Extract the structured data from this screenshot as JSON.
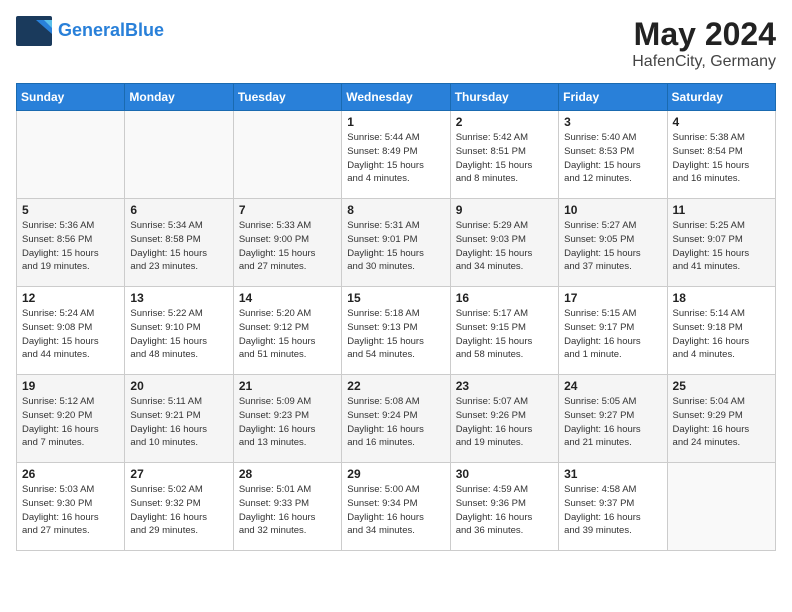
{
  "header": {
    "logo_general": "General",
    "logo_blue": "Blue",
    "title": "May 2024",
    "subtitle": "HafenCity, Germany"
  },
  "columns": [
    "Sunday",
    "Monday",
    "Tuesday",
    "Wednesday",
    "Thursday",
    "Friday",
    "Saturday"
  ],
  "weeks": [
    [
      {
        "num": "",
        "info": ""
      },
      {
        "num": "",
        "info": ""
      },
      {
        "num": "",
        "info": ""
      },
      {
        "num": "1",
        "info": "Sunrise: 5:44 AM\nSunset: 8:49 PM\nDaylight: 15 hours\nand 4 minutes."
      },
      {
        "num": "2",
        "info": "Sunrise: 5:42 AM\nSunset: 8:51 PM\nDaylight: 15 hours\nand 8 minutes."
      },
      {
        "num": "3",
        "info": "Sunrise: 5:40 AM\nSunset: 8:53 PM\nDaylight: 15 hours\nand 12 minutes."
      },
      {
        "num": "4",
        "info": "Sunrise: 5:38 AM\nSunset: 8:54 PM\nDaylight: 15 hours\nand 16 minutes."
      }
    ],
    [
      {
        "num": "5",
        "info": "Sunrise: 5:36 AM\nSunset: 8:56 PM\nDaylight: 15 hours\nand 19 minutes."
      },
      {
        "num": "6",
        "info": "Sunrise: 5:34 AM\nSunset: 8:58 PM\nDaylight: 15 hours\nand 23 minutes."
      },
      {
        "num": "7",
        "info": "Sunrise: 5:33 AM\nSunset: 9:00 PM\nDaylight: 15 hours\nand 27 minutes."
      },
      {
        "num": "8",
        "info": "Sunrise: 5:31 AM\nSunset: 9:01 PM\nDaylight: 15 hours\nand 30 minutes."
      },
      {
        "num": "9",
        "info": "Sunrise: 5:29 AM\nSunset: 9:03 PM\nDaylight: 15 hours\nand 34 minutes."
      },
      {
        "num": "10",
        "info": "Sunrise: 5:27 AM\nSunset: 9:05 PM\nDaylight: 15 hours\nand 37 minutes."
      },
      {
        "num": "11",
        "info": "Sunrise: 5:25 AM\nSunset: 9:07 PM\nDaylight: 15 hours\nand 41 minutes."
      }
    ],
    [
      {
        "num": "12",
        "info": "Sunrise: 5:24 AM\nSunset: 9:08 PM\nDaylight: 15 hours\nand 44 minutes."
      },
      {
        "num": "13",
        "info": "Sunrise: 5:22 AM\nSunset: 9:10 PM\nDaylight: 15 hours\nand 48 minutes."
      },
      {
        "num": "14",
        "info": "Sunrise: 5:20 AM\nSunset: 9:12 PM\nDaylight: 15 hours\nand 51 minutes."
      },
      {
        "num": "15",
        "info": "Sunrise: 5:18 AM\nSunset: 9:13 PM\nDaylight: 15 hours\nand 54 minutes."
      },
      {
        "num": "16",
        "info": "Sunrise: 5:17 AM\nSunset: 9:15 PM\nDaylight: 15 hours\nand 58 minutes."
      },
      {
        "num": "17",
        "info": "Sunrise: 5:15 AM\nSunset: 9:17 PM\nDaylight: 16 hours\nand 1 minute."
      },
      {
        "num": "18",
        "info": "Sunrise: 5:14 AM\nSunset: 9:18 PM\nDaylight: 16 hours\nand 4 minutes."
      }
    ],
    [
      {
        "num": "19",
        "info": "Sunrise: 5:12 AM\nSunset: 9:20 PM\nDaylight: 16 hours\nand 7 minutes."
      },
      {
        "num": "20",
        "info": "Sunrise: 5:11 AM\nSunset: 9:21 PM\nDaylight: 16 hours\nand 10 minutes."
      },
      {
        "num": "21",
        "info": "Sunrise: 5:09 AM\nSunset: 9:23 PM\nDaylight: 16 hours\nand 13 minutes."
      },
      {
        "num": "22",
        "info": "Sunrise: 5:08 AM\nSunset: 9:24 PM\nDaylight: 16 hours\nand 16 minutes."
      },
      {
        "num": "23",
        "info": "Sunrise: 5:07 AM\nSunset: 9:26 PM\nDaylight: 16 hours\nand 19 minutes."
      },
      {
        "num": "24",
        "info": "Sunrise: 5:05 AM\nSunset: 9:27 PM\nDaylight: 16 hours\nand 21 minutes."
      },
      {
        "num": "25",
        "info": "Sunrise: 5:04 AM\nSunset: 9:29 PM\nDaylight: 16 hours\nand 24 minutes."
      }
    ],
    [
      {
        "num": "26",
        "info": "Sunrise: 5:03 AM\nSunset: 9:30 PM\nDaylight: 16 hours\nand 27 minutes."
      },
      {
        "num": "27",
        "info": "Sunrise: 5:02 AM\nSunset: 9:32 PM\nDaylight: 16 hours\nand 29 minutes."
      },
      {
        "num": "28",
        "info": "Sunrise: 5:01 AM\nSunset: 9:33 PM\nDaylight: 16 hours\nand 32 minutes."
      },
      {
        "num": "29",
        "info": "Sunrise: 5:00 AM\nSunset: 9:34 PM\nDaylight: 16 hours\nand 34 minutes."
      },
      {
        "num": "30",
        "info": "Sunrise: 4:59 AM\nSunset: 9:36 PM\nDaylight: 16 hours\nand 36 minutes."
      },
      {
        "num": "31",
        "info": "Sunrise: 4:58 AM\nSunset: 9:37 PM\nDaylight: 16 hours\nand 39 minutes."
      },
      {
        "num": "",
        "info": ""
      }
    ]
  ]
}
